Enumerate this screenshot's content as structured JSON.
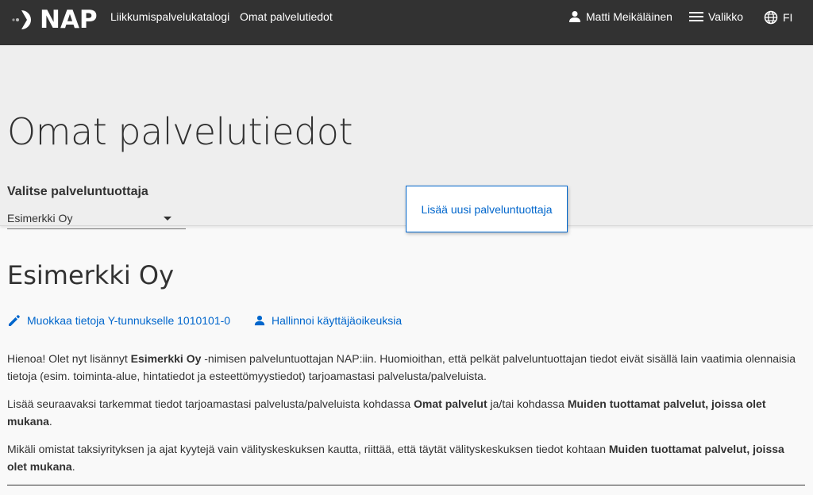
{
  "header": {
    "logo_text": "NAP",
    "nav": [
      {
        "label": "Liikkumispalvelukatalogi"
      },
      {
        "label": "Omat palvelutiedot"
      }
    ],
    "user_name": "Matti Meikäläinen",
    "menu_label": "Valikko",
    "language": "FI"
  },
  "hero": {
    "title": "Omat palvelutiedot",
    "select_label": "Valitse palveluntuottaja",
    "select_value": "Esimerkki Oy",
    "add_button": "Lisää uusi palveluntuottaja"
  },
  "company": {
    "name": "Esimerkki Oy",
    "edit_link": "Muokkaa tietoja Y-tunnukselle 1010101-0",
    "manage_link": "Hallinnoi käyttäjäoikeuksia"
  },
  "paragraphs": {
    "p1_a": "Hienoa! Olet nyt lisännyt ",
    "p1_b": "Esimerkki Oy",
    "p1_c": " -nimisen palveluntuottajan NAP:iin.  Huomioithan, että pelkät palveluntuottajan tiedot eivät sisällä lain vaatimia olennaisia tietoja (esim. toiminta-alue, hintatiedot ja esteettömyystiedot) tarjoamastasi palvelusta/palveluista.",
    "p2_a": "Lisää seuraavaksi tarkemmat tiedot tarjoamastasi palvelusta/palveluista kohdassa ",
    "p2_b": "Omat palvelut",
    "p2_c": " ja/tai kohdassa ",
    "p2_d": "Muiden tuottamat palvelut, joissa olet mukana",
    "p2_e": ".",
    "p3_a": "Mikäli omistat taksiyrityksen ja ajat kyytejä vain välityskeskuksen kautta, riittää, että täytät välityskeskuksen tiedot kohtaan ",
    "p3_b": "Muiden tuottamat palvelut, joissa olet mukana",
    "p3_c": "."
  },
  "colors": {
    "topbar": "#323232",
    "link": "#0066cc",
    "hero_bg": "#eeeeee"
  }
}
